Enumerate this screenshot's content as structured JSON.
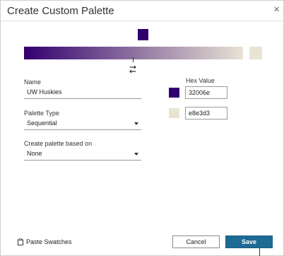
{
  "dialog": {
    "title": "Create Custom Palette",
    "close_icon": "close-icon"
  },
  "gradient": {
    "start_color": "#32006e",
    "end_color": "#e8e3d3",
    "swap_icon": "swap-arrows-icon"
  },
  "form": {
    "name_label": "Name",
    "name_value": "UW Huskies",
    "palette_type_label": "Palette Type",
    "palette_type_value": "Sequential",
    "based_on_label": "Create palette based on",
    "based_on_value": "None"
  },
  "hex": {
    "label": "Hex Value",
    "colors": [
      {
        "value": "32006e",
        "swatch": "#32006e"
      },
      {
        "value": "e8e3d3",
        "swatch": "#e8e3d3"
      }
    ]
  },
  "footer": {
    "paste_label": "Paste Swatches",
    "paste_icon": "clipboard-icon",
    "cancel_label": "Cancel",
    "save_label": "Save"
  }
}
